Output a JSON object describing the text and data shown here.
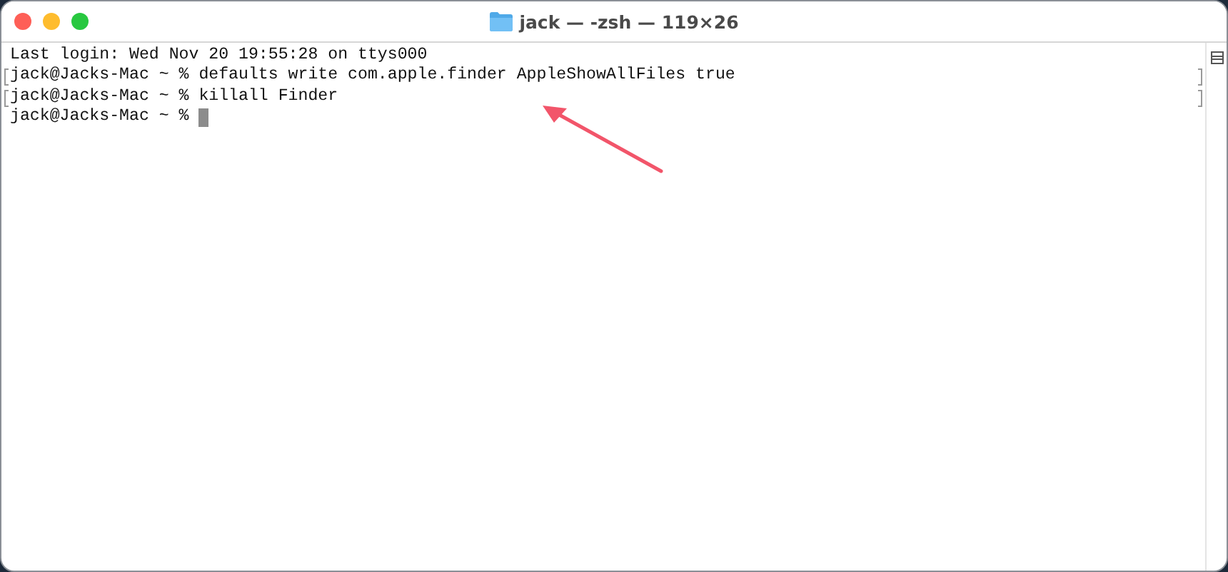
{
  "window": {
    "title": "jack — -zsh — 119×26"
  },
  "lines": [
    {
      "text": "Last login: Wed Nov 20 19:55:28 on ttys000",
      "marked": false,
      "cursor": false
    },
    {
      "text": "jack@Jacks-Mac ~ % defaults write com.apple.finder AppleShowAllFiles true",
      "marked": true,
      "cursor": false
    },
    {
      "text": "jack@Jacks-Mac ~ % killall Finder",
      "marked": true,
      "cursor": false
    },
    {
      "text": "jack@Jacks-Mac ~ %",
      "marked": false,
      "cursor": true
    }
  ]
}
